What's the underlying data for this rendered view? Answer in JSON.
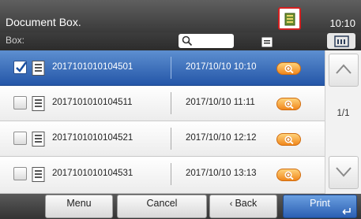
{
  "header": {
    "title": "Document Box.",
    "time": "10:10",
    "status_icon": "job-status-icon",
    "box_label": "Box:"
  },
  "files": [
    {
      "name": "2017101010104501",
      "date": "2017/10/10 10:10",
      "selected": true
    },
    {
      "name": "2017101010104511",
      "date": "2017/10/10 11:11",
      "selected": false
    },
    {
      "name": "2017101010104521",
      "date": "2017/10/10 12:12",
      "selected": false
    },
    {
      "name": "2017101010104531",
      "date": "2017/10/10 13:13",
      "selected": false
    }
  ],
  "scroll": {
    "page": "1/1"
  },
  "footer": {
    "menu": "Menu",
    "cancel": "Cancel",
    "back": "Back",
    "print": "Print"
  },
  "colors": {
    "selected_row": "#2f63b5",
    "preview_button": "#f0871c",
    "status_border": "#d42020"
  }
}
